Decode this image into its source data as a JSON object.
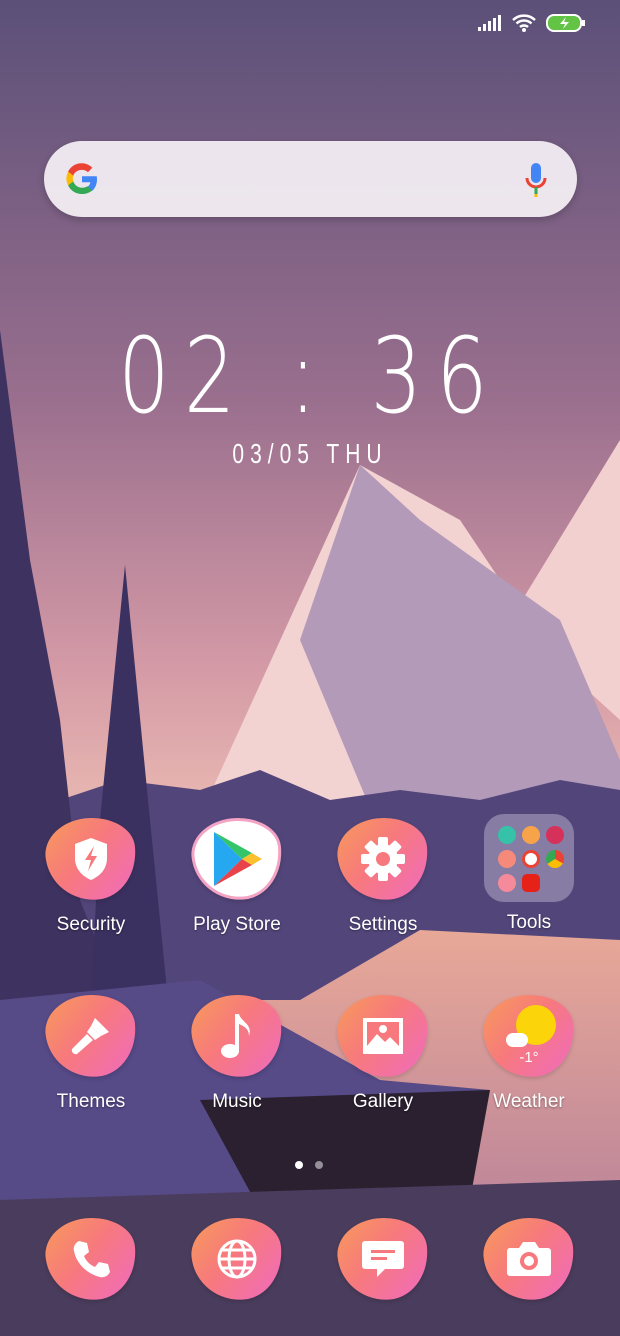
{
  "status": {
    "signal": "signal-icon",
    "wifi": "wifi-icon",
    "battery": "battery-charging-icon"
  },
  "search": {
    "logo": "G",
    "mic": "mic-icon"
  },
  "clock": {
    "time": "02 : 36",
    "date": "03/05 THU"
  },
  "apps": [
    {
      "label": "Security",
      "icon": "shield-icon"
    },
    {
      "label": "Play Store",
      "icon": "play-store-icon"
    },
    {
      "label": "Settings",
      "icon": "gear-icon"
    },
    {
      "label": "Tools",
      "icon": "folder-icon"
    },
    {
      "label": "Themes",
      "icon": "brush-icon"
    },
    {
      "label": "Music",
      "icon": "music-note-icon"
    },
    {
      "label": "Gallery",
      "icon": "image-icon"
    },
    {
      "label": "Weather",
      "icon": "weather-icon",
      "temp": "-1°"
    }
  ],
  "page_indicator": {
    "pages": 2,
    "current": 1
  },
  "dock": [
    {
      "name": "phone",
      "icon": "phone-icon"
    },
    {
      "name": "browser",
      "icon": "globe-icon"
    },
    {
      "name": "messages",
      "icon": "message-icon"
    },
    {
      "name": "camera",
      "icon": "camera-icon"
    }
  ]
}
